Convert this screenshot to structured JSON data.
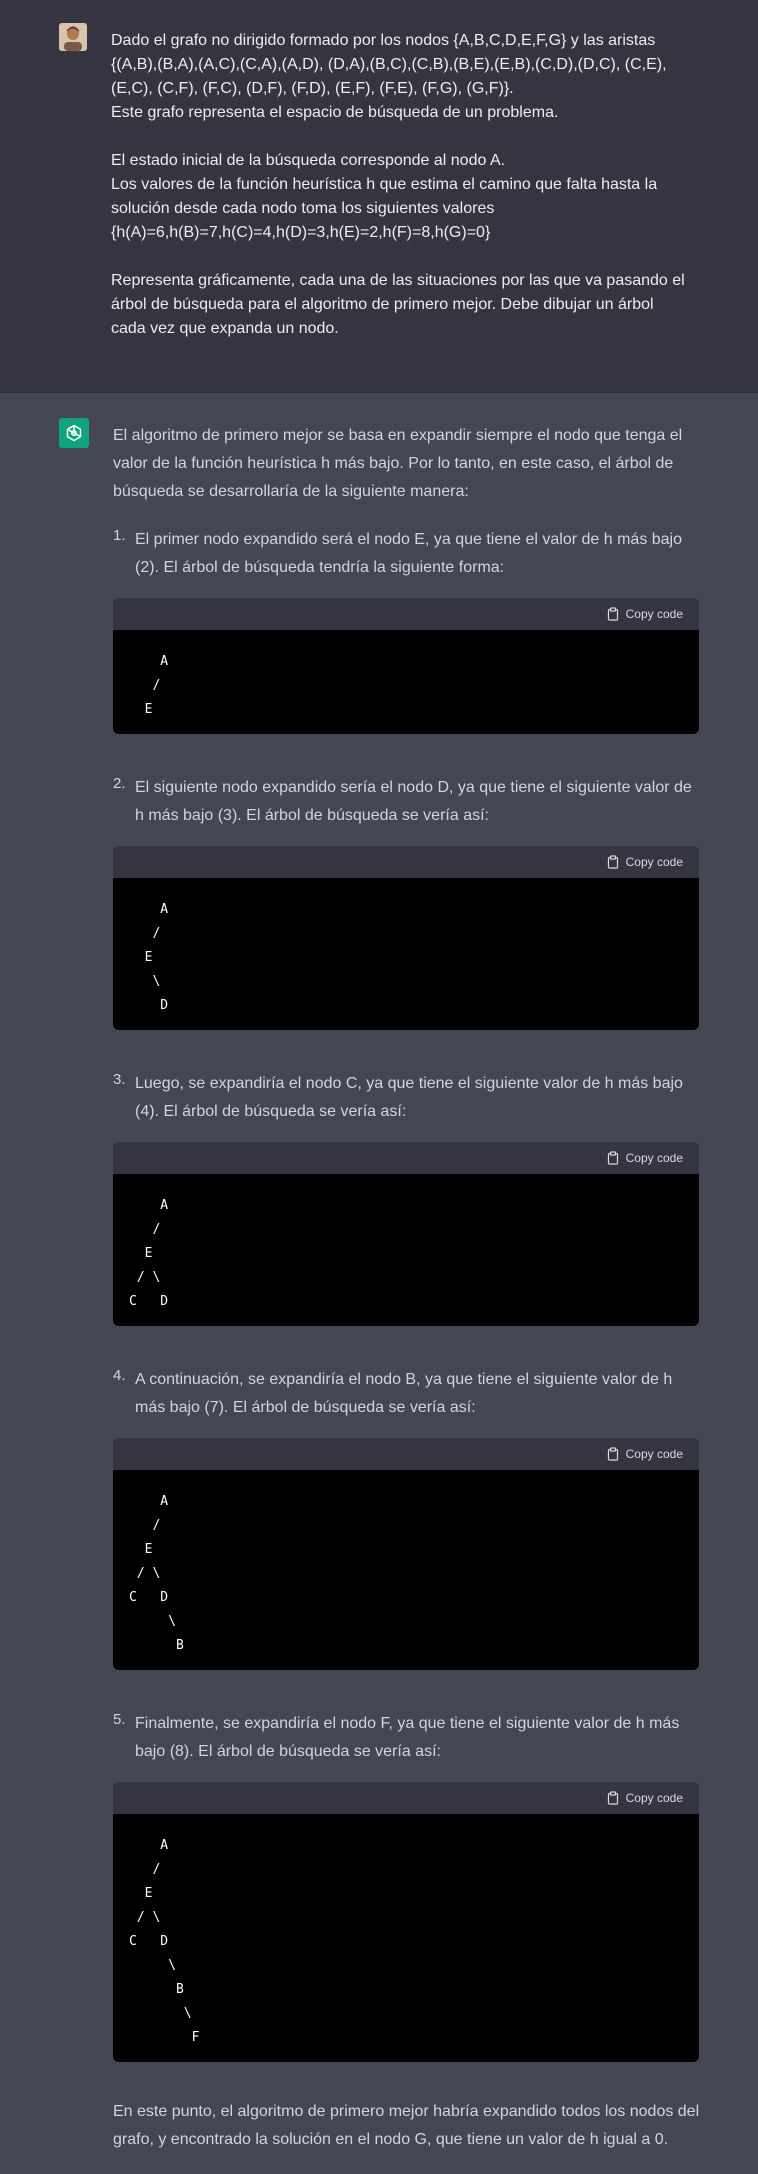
{
  "user": {
    "avatar": "user-avatar",
    "paragraphs": [
      "Dado el grafo no dirigido formado por los nodos {A,B,C,D,E,F,G} y las aristas\n{(A,B),(B,A),(A,C),(C,A),(A,D), (D,A),(B,C),(C,B),(B,E),(E,B),(C,D),(D,C), (C,E),\n(E,C), (C,F), (F,C), (D,F), (F,D), (E,F), (F,E), (F,G), (G,F)}.\nEste grafo representa el espacio de búsqueda de un problema.",
      "El estado inicial de la búsqueda corresponde al nodo A.\nLos valores de la función heurística h que estima el camino que falta hasta la\nsolución desde cada nodo toma los siguientes valores\n{h(A)=6,h(B)=7,h(C)=4,h(D)=3,h(E)=2,h(F)=8,h(G)=0}",
      "Representa gráficamente, cada una de las situaciones por las que va pasando el\nárbol de búsqueda para el algoritmo de primero mejor. Debe dibujar un árbol\ncada vez que expanda un nodo."
    ]
  },
  "assistant": {
    "intro": "El algoritmo de primero mejor se basa en expandir siempre el nodo que tenga el valor de la función heurística h más bajo. Por lo tanto, en este caso, el árbol de búsqueda se desarrollaría de la siguiente manera:",
    "copy_label": "Copy code",
    "steps": [
      {
        "num": "1.",
        "text": "El primer nodo expandido será el nodo E, ya que tiene el valor de h más bajo (2). El árbol de búsqueda tendría la siguiente forma:",
        "code": "    A\n   /\n  E"
      },
      {
        "num": "2.",
        "text": "El siguiente nodo expandido sería el nodo D, ya que tiene el siguiente valor de h más bajo (3). El árbol de búsqueda se vería así:",
        "code": "    A\n   /\n  E\n   \\\n    D"
      },
      {
        "num": "3.",
        "text": "Luego, se expandiría el nodo C, ya que tiene el siguiente valor de h más bajo (4). El árbol de búsqueda se vería así:",
        "code": "    A\n   /\n  E\n / \\\nC   D"
      },
      {
        "num": "4.",
        "text": "A continuación, se expandiría el nodo B, ya que tiene el siguiente valor de h más bajo (7). El árbol de búsqueda se vería así:",
        "code": "    A\n   /\n  E\n / \\\nC   D\n     \\\n      B"
      },
      {
        "num": "5.",
        "text": "Finalmente, se expandiría el nodo F, ya que tiene el siguiente valor de h más bajo (8). El árbol de búsqueda se vería así:",
        "code": "    A\n   /\n  E\n / \\\nC   D\n     \\\n      B\n       \\\n        F"
      }
    ],
    "final": "En este punto, el algoritmo de primero mejor habría expandido todos los nodos del grafo, y encontrado la solución en el nodo G, que tiene un valor de h igual a 0."
  },
  "colors": {
    "user_bg": "#343541",
    "assistant_bg": "#444654",
    "code_bg": "#000000",
    "gpt_green": "#10a37f"
  }
}
